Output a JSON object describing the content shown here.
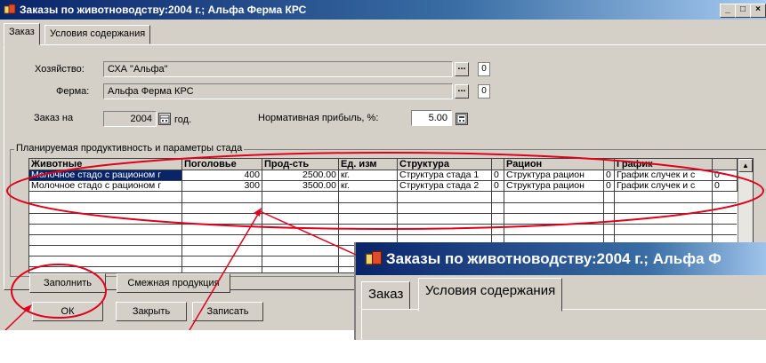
{
  "window": {
    "title": "Заказы по животноводству:2004 г.; Альфа Ферма КРС",
    "controls": [
      "_",
      "□",
      "×"
    ]
  },
  "tabs": [
    {
      "label": "Заказ"
    },
    {
      "label": "Условия содержания"
    }
  ],
  "form": {
    "owner_label": "Хозяйство:",
    "owner_value": "СХА \"Альфа\"",
    "owner_code": "0",
    "farm_label": "Ферма:",
    "farm_value": "Альфа Ферма КРС",
    "farm_code": "0",
    "order_label": "Заказ на",
    "order_year": "2004",
    "order_unit": "год.",
    "profit_label": "Нормативная прибыль, %:",
    "profit_value": "5.00",
    "lookup_glyph": "..."
  },
  "group": {
    "title": "Планируемая продуктивность и параметры стада"
  },
  "grid": {
    "columns": [
      "Животные",
      "Поголовье",
      "Прод-сть",
      "Ед. изм",
      "Структура",
      "",
      "Рацион",
      "",
      "График",
      ""
    ],
    "rows": [
      [
        "Молочное стадо с рационом г",
        "400",
        "2500.00",
        "кг.",
        "Структура стада 1",
        "0",
        "Структура рацион",
        "0",
        "График случек и с",
        "0"
      ],
      [
        "Молочное стадо с рационом г",
        "300",
        "3500.00",
        "кг.",
        "Структура стада 2",
        "0",
        "Структура рацион",
        "0",
        "График случек и с",
        "0"
      ]
    ]
  },
  "buttons": {
    "fill": "Заполнить",
    "related": "Смежная продукция",
    "ok": "ОК",
    "close": "Закрыть",
    "save": "Записать"
  },
  "zoom": {
    "title": "Заказы по животноводству:2004 г.; Альфа Ф",
    "tab_order": "Заказ",
    "tab_conditions": "Условия содержания"
  },
  "colors": {
    "annotation": "#e0001b",
    "title_gradient_start": "#0a246a",
    "selection": "#0a246a"
  }
}
